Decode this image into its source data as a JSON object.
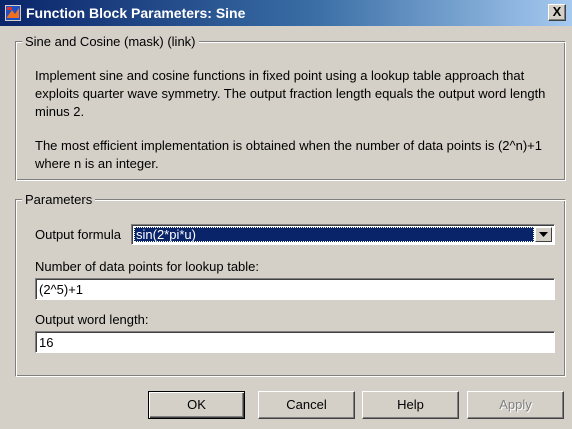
{
  "window": {
    "title": "Function Block Parameters: Sine",
    "icon": "simulink-block-icon",
    "close_label": "X"
  },
  "description_group": {
    "legend": "Sine and Cosine (mask) (link)",
    "paragraph1": "Implement sine and cosine functions in fixed point using a lookup table approach that exploits quarter wave symmetry. The output fraction length equals the output word length minus 2.",
    "paragraph2": "The most efficient implementation is obtained when the number of data points is (2^n)+1 where n is an integer."
  },
  "parameters_group": {
    "legend": "Parameters",
    "output_formula_label": "Output formula",
    "output_formula_value": "sin(2*pi*u)",
    "data_points_label": "Number of data points for lookup table:",
    "data_points_value": "(2^5)+1",
    "word_length_label": "Output word length:",
    "word_length_value": "16"
  },
  "buttons": {
    "ok": "OK",
    "cancel": "Cancel",
    "help": "Help",
    "apply": "Apply"
  },
  "colors": {
    "titlebar_start": "#0a246a",
    "titlebar_end": "#a6caf0",
    "dialog_face": "#d4d0c8",
    "selection": "#0a246a"
  }
}
